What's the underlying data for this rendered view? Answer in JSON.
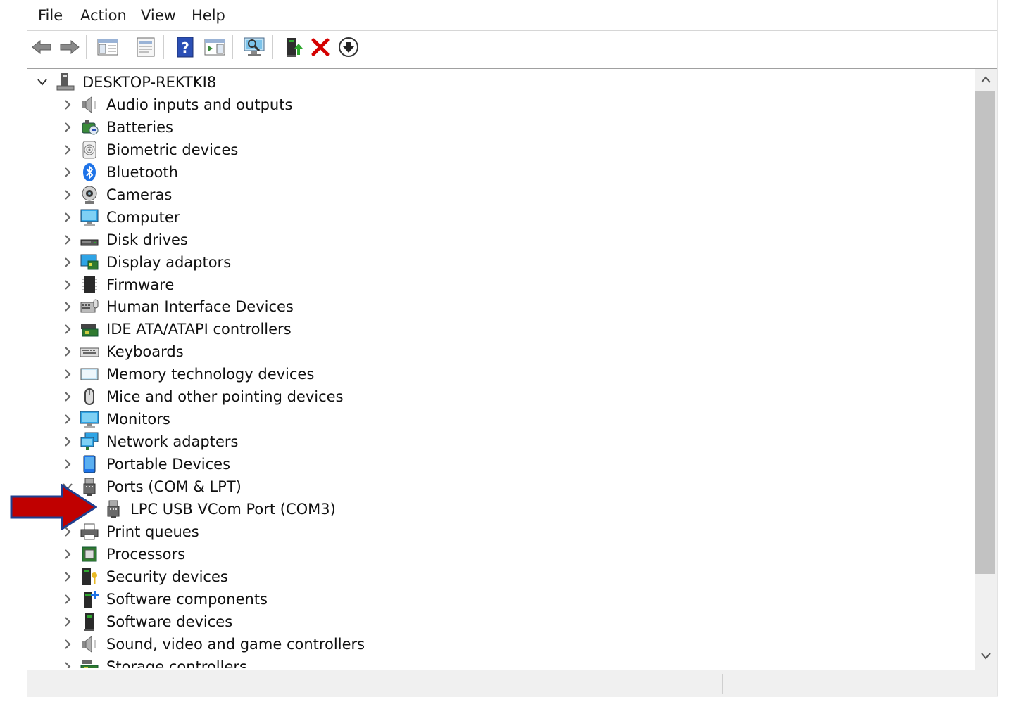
{
  "menu": [
    "File",
    "Action",
    "View",
    "Help"
  ],
  "toolbar": {
    "buttons": [
      "back-arrow-icon",
      "forward-arrow-icon",
      "show-hide-console-tree-icon",
      "properties-icon",
      "help-icon",
      "action-pane-icon",
      "scan-hardware-icon",
      "update-driver-icon",
      "uninstall-device-icon",
      "disable-device-icon"
    ],
    "colors": {
      "uninstall": "#d40000",
      "help": "#2b4fb5",
      "update_green": "#2fa82f"
    }
  },
  "tree": {
    "root": "DESKTOP-REKTKI8",
    "categories": [
      {
        "label": "Audio inputs and outputs",
        "icon": "speaker-icon",
        "expanded": false
      },
      {
        "label": "Batteries",
        "icon": "battery-icon",
        "expanded": false
      },
      {
        "label": "Biometric devices",
        "icon": "fingerprint-icon",
        "expanded": false
      },
      {
        "label": "Bluetooth",
        "icon": "bluetooth-icon",
        "expanded": false
      },
      {
        "label": "Cameras",
        "icon": "camera-icon",
        "expanded": false
      },
      {
        "label": "Computer",
        "icon": "computer-icon",
        "expanded": false
      },
      {
        "label": "Disk drives",
        "icon": "disk-drive-icon",
        "expanded": false
      },
      {
        "label": "Display adaptors",
        "icon": "display-adapter-icon",
        "expanded": false
      },
      {
        "label": "Firmware",
        "icon": "firmware-chip-icon",
        "expanded": false
      },
      {
        "label": "Human Interface Devices",
        "icon": "hid-icon",
        "expanded": false
      },
      {
        "label": "IDE ATA/ATAPI controllers",
        "icon": "ide-controller-icon",
        "expanded": false
      },
      {
        "label": "Keyboards",
        "icon": "keyboard-icon",
        "expanded": false
      },
      {
        "label": "Memory technology devices",
        "icon": "memory-device-icon",
        "expanded": false
      },
      {
        "label": "Mice and other pointing devices",
        "icon": "mouse-icon",
        "expanded": false
      },
      {
        "label": "Monitors",
        "icon": "monitor-icon",
        "expanded": false
      },
      {
        "label": "Network adapters",
        "icon": "network-adapter-icon",
        "expanded": false
      },
      {
        "label": "Portable Devices",
        "icon": "portable-device-icon",
        "expanded": false
      },
      {
        "label": "Ports (COM & LPT)",
        "icon": "port-icon",
        "expanded": true,
        "children": [
          {
            "label": "LPC USB VCom Port (COM3)",
            "icon": "port-icon"
          }
        ]
      },
      {
        "label": "Print queues",
        "icon": "printer-icon",
        "expanded": false
      },
      {
        "label": "Processors",
        "icon": "processor-icon",
        "expanded": false
      },
      {
        "label": "Security devices",
        "icon": "security-device-icon",
        "expanded": false
      },
      {
        "label": "Software components",
        "icon": "software-component-icon",
        "expanded": false
      },
      {
        "label": "Software devices",
        "icon": "software-device-icon",
        "expanded": false
      },
      {
        "label": "Sound, video and game controllers",
        "icon": "sound-controller-icon",
        "expanded": false
      },
      {
        "label": "Storage controllers",
        "icon": "storage-controller-icon",
        "expanded": false
      }
    ]
  },
  "annotation": {
    "arrow_color": "#c00000",
    "arrow_outline": "#1f3f8f"
  }
}
